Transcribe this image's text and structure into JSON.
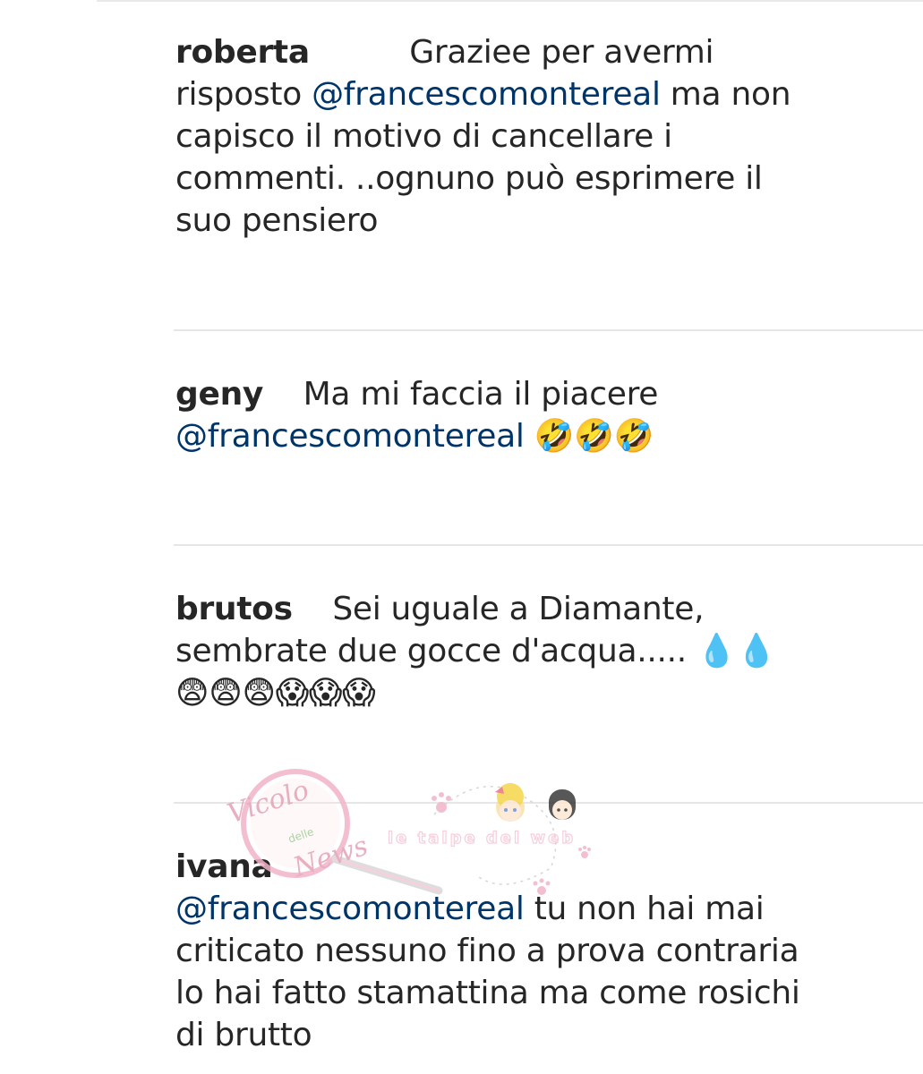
{
  "comments": [
    {
      "username": "roberta",
      "gap": "          ",
      "text_before": "Graziee per avermi risposto ",
      "mention": "@francescomontereal",
      "text_after": "  ma non capisco il motivo di cancellare i commenti. ..ognuno può esprimere il suo pensiero"
    },
    {
      "username": "geny",
      "gap": "    ",
      "text_before": "Ma mi faccia il piacere ",
      "mention": "@francescomontereal",
      "text_after": " 🤣🤣🤣"
    },
    {
      "username": "brutos",
      "gap": "    ",
      "text_before": "Sei uguale a Diamante, sembrate due gocce d'acqua..... 💧💧 😨😨😨😱😱😱"
    },
    {
      "username": "ivana",
      "mention": "@francescomontereal",
      "text_after": " tu non hai mai criticato nessuno fino a prova contraria lo hai fatto stamattina ma come rosichi di brutto"
    }
  ],
  "watermark": {
    "logo_text": "Vicolo delle News",
    "tagline": "le talpe del web"
  },
  "colors": {
    "mention": "#003569",
    "username": "#262626",
    "text": "#262626",
    "divider": "#e6e6e6",
    "watermark_pink": "#f2b5c8",
    "watermark_purple": "#b58fd0"
  }
}
